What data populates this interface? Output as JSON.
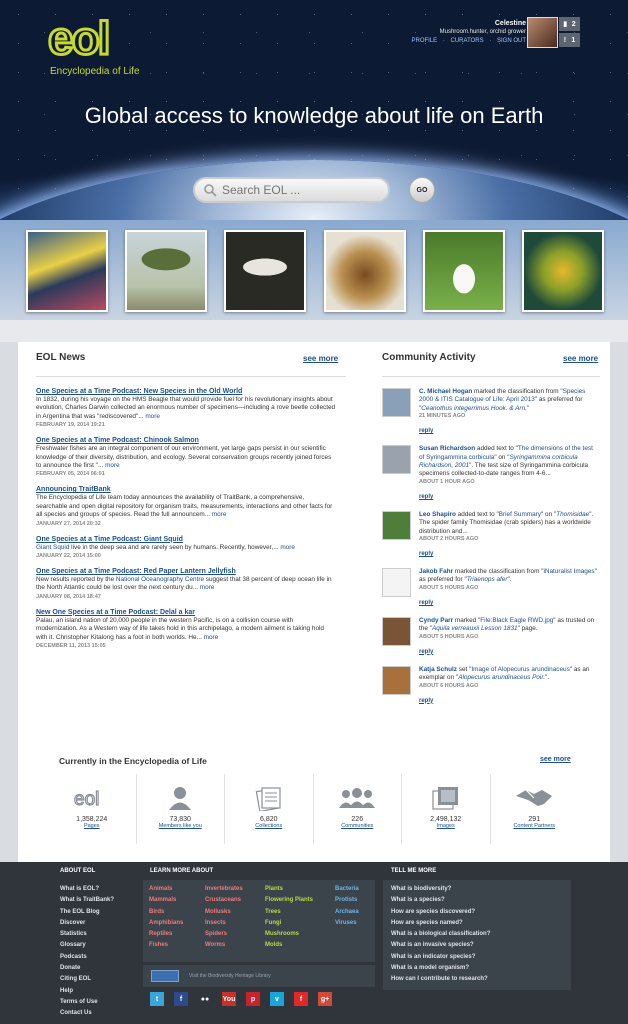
{
  "header": {
    "logo_text": "EOL",
    "logo_subtitle": "Encyclopedia of Life",
    "user": {
      "name": "Celestine",
      "role": "Mushroom hunter, orchid grower",
      "links": [
        "PROFILE",
        "CURATORS",
        "SIGN OUT"
      ],
      "message_count": "2",
      "alert_count": "1"
    },
    "tagline": "Global access to knowledge about life on Earth",
    "search": {
      "placeholder": "Search EOL ...",
      "button": "GO"
    }
  },
  "news": {
    "title": "EOL News",
    "see_more": "see more",
    "items": [
      {
        "title": "One Species at a Time Podcast: New Species in the Old World",
        "body": "In 1832, during his voyage on the HMS Beagle that would provide fuel for his revolutionary insights about evolution, Charles Darwin collected an enormous number of specimens—including a rove beetle collected in Argentina that was \"rediscovered\"...",
        "more": "more",
        "date": "FEBRUARY 19, 2014 19:21"
      },
      {
        "title": "One Species at a Time Podcast: Chinook Salmon",
        "body": "Freshwater fishes are an integral component of our environment, yet large gaps persist in our scientific knowledge of their diversity, distribution, and ecology. Several conservation groups recently joined forces to announce the first \"...",
        "more": "more",
        "date": "FEBRUARY 05, 2014 06:01"
      },
      {
        "title": "Announcing TraitBank",
        "body": "The Encyclopedia of Life team today announces the availability of TraitBank, a comprehensive, searchable and open digital repository for organism traits, measurements, interactions and other facts for all species and groups of species. Read the full announcem...",
        "more": "more",
        "date": "JANUARY 27, 2014 20:32"
      },
      {
        "title": "One Species at a Time Podcast: Giant Squid",
        "body_link": "Giant Squid",
        "body": " live in the deep sea and are rarely seen by humans. Recently, however,...",
        "more": "more",
        "date": "JANUARY 22, 2014 15:00"
      },
      {
        "title": "One Species at a Time Podcast: Red Paper Lantern Jellyfish",
        "body_pre": "New results reported by the ",
        "body_link": "National Oceanography Centre",
        "body": " suggest that 38 percent of deep ocean life in the North Atlantic could be lost over the next century du...",
        "more": "more",
        "date": "JANUARY 08, 2014 18:47"
      },
      {
        "title": "New One Species at a Time Podcast: Delal a kar",
        "body": "Palau, an island nation of 20,000 people in the western Pacific, is on a collision course with modernization. As a Western way of life takes hold in this archipelago, a modern ailment is taking hold with it. Christopher Kitalong has a foot in both worlds. He...",
        "more": "more",
        "date": "DECEMBER 11, 2013 15:05"
      }
    ]
  },
  "community": {
    "title": "Community Activity",
    "see_more": "see more",
    "items": [
      {
        "user": "C. Michael Hogan",
        "pre": " marked the classification from \"",
        "l1": "Species 2000 & ITIS Catalogue of Life: April 2013",
        "mid": "\" as preferred for \"",
        "l2": "Ceanothus integerrimus Hook. & Arn.",
        "post": "\"",
        "date": "21 MINUTES AGO",
        "reply": "reply",
        "avatar_color": "#8aa0b8"
      },
      {
        "user": "Susan Richardson",
        "pre": " added text to \"",
        "l1": "The dimensions of the test of Syringammina corbicula",
        "mid": "\" on \"",
        "l2": "Syringammina corbicula Richardson, 2001",
        "post": "\". The test size of Syringammina corbicula specimens collected-to-date ranges from 4-6...",
        "date": "ABOUT 1 HOUR AGO",
        "reply": "reply",
        "avatar_color": "#9aa3ad"
      },
      {
        "user": "Leo Shapiro",
        "pre": " added text to \"",
        "l1": "Brief Summary",
        "mid": "\" on \"",
        "l2": "Thomisidae",
        "post": "\". The spider family Thomisidae (crab spiders) has a worldwide distribution and...",
        "date": "ABOUT 2 HOURS AGO",
        "reply": "reply",
        "avatar_color": "#4f7d3a"
      },
      {
        "user": "Jakob Fahr",
        "pre": " marked the classification from \"",
        "l1": "iNaturalist Images",
        "mid": "\" as preferred for \"",
        "l2": "Triaenops afer",
        "post": "\".",
        "date": "ABOUT 5 HOURS AGO",
        "reply": "reply",
        "avatar_color": "#f4f4f4"
      },
      {
        "user": "Cyndy Parr",
        "pre": " marked \"",
        "l1": "File:Black Eagle RWD.jpg",
        "mid": "\" as trusted on the \"",
        "l2": "Aquila verreauxii Lesson 1831",
        "post": "\" page.",
        "date": "ABOUT 5 HOURS AGO",
        "reply": "reply",
        "avatar_color": "#7a5436"
      },
      {
        "user": "Katja Schulz",
        "pre": " set \"",
        "l1": "Image of Alopecurus arundinaceus",
        "mid": "\" as an exemplar on \"",
        "l2": "Alopecurus arundinaceus Poir.",
        "post": "\".",
        "date": "ABOUT 6 HOURS AGO",
        "reply": "reply",
        "avatar_color": "#a8703a"
      }
    ]
  },
  "stats": {
    "title": "Currently in the Encyclopedia of Life",
    "see_more": "see more",
    "items": [
      {
        "icon": "eol-logo-icon",
        "value": "1,358,224",
        "label": "Pages"
      },
      {
        "icon": "person-icon",
        "value": "73,830",
        "label": "Members like you"
      },
      {
        "icon": "collections-icon",
        "value": "6,820",
        "label": "Collections"
      },
      {
        "icon": "communities-icon",
        "value": "226",
        "label": "Communities"
      },
      {
        "icon": "images-icon",
        "value": "2,498,132",
        "label": "Images"
      },
      {
        "icon": "handshake-icon",
        "value": "291",
        "label": "Content Partners"
      }
    ]
  },
  "footer": {
    "about_heading": "ABOUT EOL",
    "about_links": [
      "What is EOL?",
      "What is TraitBank?",
      "The EOL Blog",
      "Discover",
      "Statistics",
      "Glossary",
      "Podcasts",
      "Donate",
      "Citing EOL",
      "Help",
      "Terms of Use",
      "Contact Us"
    ],
    "learn_heading": "LEARN MORE ABOUT",
    "learn_cols": [
      {
        "color": "#f07b7b",
        "items": [
          "Animals",
          "Mammals",
          "Birds",
          "Amphibians",
          "Reptiles",
          "Fishes"
        ]
      },
      {
        "color": "#f07b7b",
        "items": [
          "Invertebrates",
          "Crustaceans",
          "Mollusks",
          "Insects",
          "Spiders",
          "Worms"
        ]
      },
      {
        "color": "#b9d94a",
        "items": [
          "Plants",
          "Flowering Plants",
          "Trees",
          "Fungi",
          "Mushrooms",
          "Molds"
        ]
      },
      {
        "color": "#6fb6e6",
        "items": [
          "Bacteria",
          "Protists",
          "Archaea",
          "Viruses"
        ]
      }
    ],
    "bhl_text": "Visit the Biodiversity Heritage Library",
    "tell_heading": "TELL ME MORE",
    "tell_links": [
      "What is biodiversity?",
      "What is a species?",
      "How are species discovered?",
      "How are species named?",
      "What is a biological classification?",
      "What is an invasive species?",
      "What is an indicator species?",
      "What is a model organism?",
      "How can I contribute to research?"
    ],
    "social": [
      {
        "name": "twitter-icon",
        "glyph": "t",
        "color": "#3aa5d8"
      },
      {
        "name": "facebook-icon",
        "glyph": "f",
        "color": "#2d4b8c"
      },
      {
        "name": "flickr-icon",
        "glyph": "●●",
        "color": "#2f353b"
      },
      {
        "name": "youtube-icon",
        "glyph": "You",
        "color": "#c8302a"
      },
      {
        "name": "pinterest-icon",
        "glyph": "p",
        "color": "#c8232c"
      },
      {
        "name": "vimeo-icon",
        "glyph": "v",
        "color": "#1aa6d4"
      },
      {
        "name": "flipboard-icon",
        "glyph": "f",
        "color": "#e12828"
      },
      {
        "name": "googleplus-icon",
        "glyph": "g+",
        "color": "#d34836"
      }
    ]
  }
}
